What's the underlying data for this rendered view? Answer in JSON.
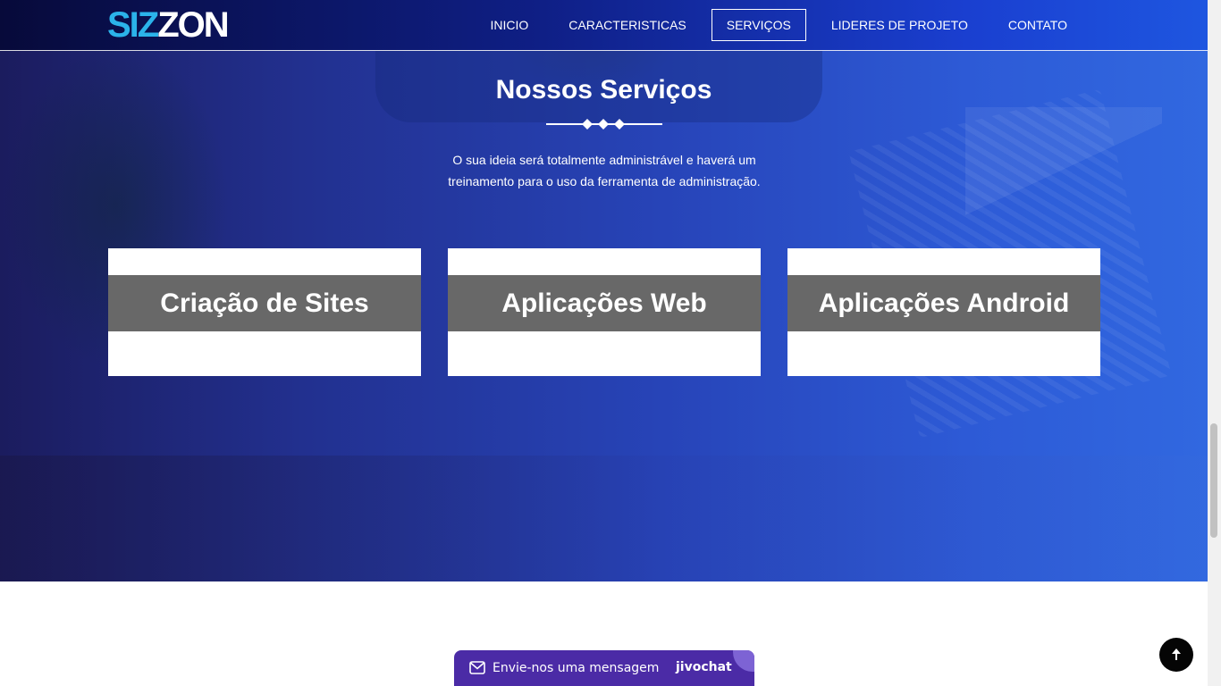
{
  "header": {
    "logo_part1": "SIZ",
    "logo_part2": "ZON",
    "nav": [
      {
        "label": "INICIO"
      },
      {
        "label": "CARACTERISTICAS"
      },
      {
        "label": "SERVIÇOS"
      },
      {
        "label": "LIDERES DE PROJETO"
      },
      {
        "label": "CONTATO"
      }
    ],
    "active_nav": "SERVIÇOS"
  },
  "services": {
    "title": "Nossos Serviços",
    "subtitle": "O sua ideia será totalmente administrável e haverá um treinamento para o uso da ferramenta de administração.",
    "cards": [
      {
        "label": "Criação de Sites"
      },
      {
        "label": "Aplicações Web"
      },
      {
        "label": "Aplicações Android"
      }
    ]
  },
  "chat": {
    "message": "Envie-nos uma mensagem",
    "brand": "jivochat"
  },
  "colors": {
    "logo_accent": "#2bb3ea",
    "card_band": "#686868",
    "chat_bg": "#4b2ba6",
    "hero_gradient_start": "#1b1c5e",
    "hero_gradient_end": "#3168e0"
  },
  "icons": {
    "divider": "diamond-icon",
    "chat": "mail-icon",
    "back_to_top": "arrow-up-icon"
  }
}
